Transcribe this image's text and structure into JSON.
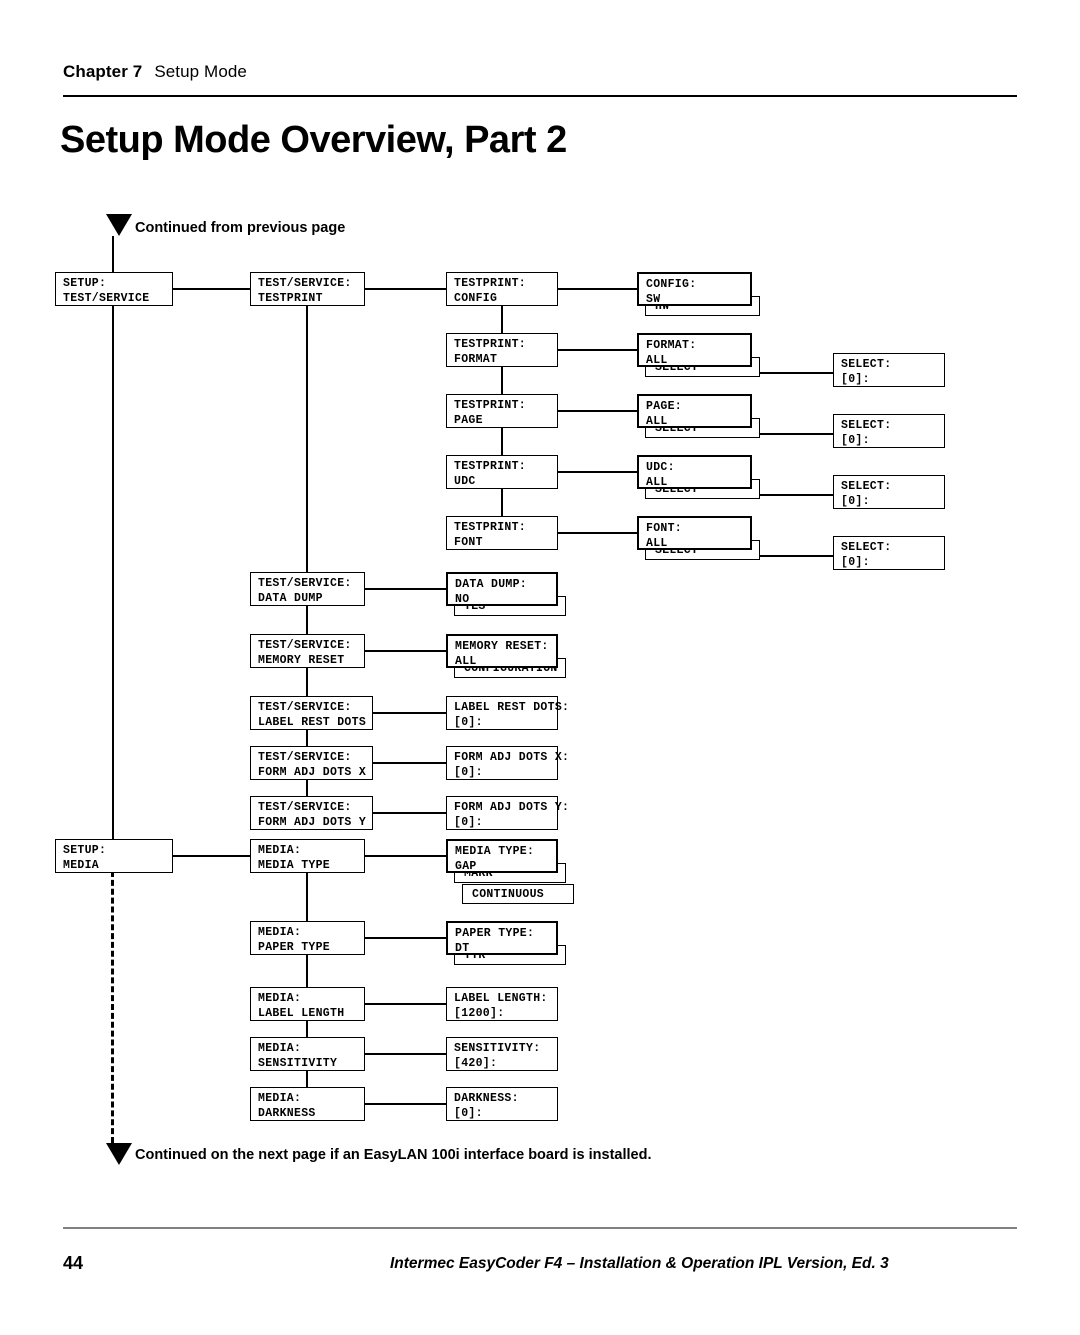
{
  "header": {
    "chapter": "Chapter 7",
    "chapter_subject": "Setup Mode",
    "title": "Setup Mode Overview, Part 2"
  },
  "notes": {
    "top": "Continued from previous page",
    "bottom": "Continued on the next page if an EasyLAN 100i interface board is installed."
  },
  "footer": {
    "page_number": "44",
    "book_line": "Intermec EasyCoder F4 – Installation & Operation  IPL Version, Ed. 3"
  },
  "diagram": {
    "type": "menu-tree-flowchart",
    "nodes": {
      "setup_testservice": {
        "l1": "SETUP:",
        "l2": "TEST/SERVICE"
      },
      "setup_media": {
        "l1": "SETUP:",
        "l2": "MEDIA"
      },
      "ts_testprint": {
        "l1": "TEST/SERVICE:",
        "l2": "TESTPRINT"
      },
      "ts_datadump": {
        "l1": "TEST/SERVICE:",
        "l2": "DATA DUMP"
      },
      "ts_memreset": {
        "l1": "TEST/SERVICE:",
        "l2": "MEMORY RESET"
      },
      "ts_labelrest": {
        "l1": "TEST/SERVICE:",
        "l2": "LABEL REST DOTS"
      },
      "ts_formadjx": {
        "l1": "TEST/SERVICE:",
        "l2": "FORM ADJ DOTS X"
      },
      "ts_formadjy": {
        "l1": "TEST/SERVICE:",
        "l2": "FORM ADJ DOTS Y"
      },
      "tp_config": {
        "l1": "TESTPRINT:",
        "l2": "CONFIG"
      },
      "tp_format": {
        "l1": "TESTPRINT:",
        "l2": "FORMAT"
      },
      "tp_page": {
        "l1": "TESTPRINT:",
        "l2": "PAGE"
      },
      "tp_udc": {
        "l1": "TESTPRINT:",
        "l2": "UDC"
      },
      "tp_font": {
        "l1": "TESTPRINT:",
        "l2": "FONT"
      },
      "config_opt": {
        "l1": "CONFIG:",
        "l2": "SW",
        "stack": [
          "HW"
        ]
      },
      "format_opt": {
        "l1": "FORMAT:",
        "l2": "ALL",
        "stack": [
          "SELECT"
        ]
      },
      "page_opt": {
        "l1": "PAGE:",
        "l2": "ALL",
        "stack": [
          "SELECT"
        ]
      },
      "udc_opt": {
        "l1": "UDC:",
        "l2": "ALL",
        "stack": [
          "SELECT"
        ]
      },
      "font_opt": {
        "l1": "FONT:",
        "l2": "ALL",
        "stack": [
          "SELECT"
        ]
      },
      "select_format": {
        "l1": "SELECT:",
        "l2": "[0]:"
      },
      "select_page": {
        "l1": "SELECT:",
        "l2": "[0]:"
      },
      "select_udc": {
        "l1": "SELECT:",
        "l2": "[0]:"
      },
      "select_font": {
        "l1": "SELECT:",
        "l2": "[0]:"
      },
      "datadump_opt": {
        "l1": "DATA DUMP:",
        "l2": "NO",
        "stack": [
          "YES"
        ]
      },
      "memreset_opt": {
        "l1": "MEMORY RESET:",
        "l2": "ALL",
        "stack": [
          "CONFIGURATION"
        ]
      },
      "labelrest_val": {
        "l1": "LABEL REST DOTS:",
        "l2": "[0]:"
      },
      "formadjx_val": {
        "l1": "FORM ADJ DOTS X:",
        "l2": "[0]:"
      },
      "formadjy_val": {
        "l1": "FORM ADJ DOTS Y:",
        "l2": "[0]:"
      },
      "media_mediatype": {
        "l1": "MEDIA:",
        "l2": "MEDIA TYPE"
      },
      "media_papertype": {
        "l1": "MEDIA:",
        "l2": "PAPER TYPE"
      },
      "media_labellength": {
        "l1": "MEDIA:",
        "l2": "LABEL LENGTH"
      },
      "media_sensitivity": {
        "l1": "MEDIA:",
        "l2": "SENSITIVITY"
      },
      "media_darkness": {
        "l1": "MEDIA:",
        "l2": "DARKNESS"
      },
      "mediatype_opt": {
        "l1": "MEDIA TYPE:",
        "l2": "GAP",
        "stack": [
          "MARK",
          "CONTINUOUS"
        ]
      },
      "papertype_opt": {
        "l1": "PAPER TYPE:",
        "l2": "DT",
        "stack": [
          "TTR"
        ]
      },
      "labellength_val": {
        "l1": "LABEL LENGTH:",
        "l2": "[1200]:"
      },
      "sensitivity_val": {
        "l1": "SENSITIVITY:",
        "l2": "[420]:"
      },
      "darkness_val": {
        "l1": "DARKNESS:",
        "l2": "[0]:"
      }
    }
  }
}
